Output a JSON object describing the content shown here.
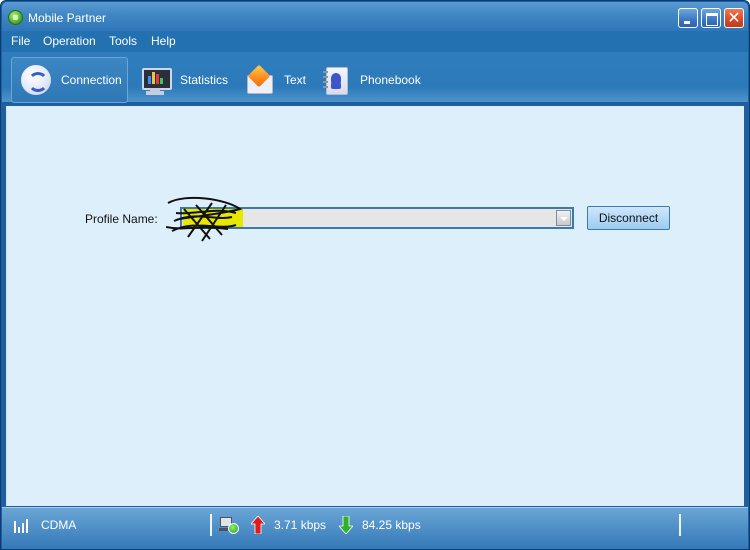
{
  "window": {
    "title": "Mobile Partner",
    "controls": {
      "minimize": "minimize",
      "maximize": "maximize",
      "close": "✕"
    }
  },
  "menu": {
    "items": [
      {
        "label": "File"
      },
      {
        "label": "Operation"
      },
      {
        "label": "Tools"
      },
      {
        "label": "Help"
      }
    ]
  },
  "toolbar": {
    "items": [
      {
        "label": "Connection",
        "icon": "connection-icon",
        "active": true
      },
      {
        "label": "Statistics",
        "icon": "statistics-icon",
        "active": false
      },
      {
        "label": "Text",
        "icon": "envelope-icon",
        "active": false
      },
      {
        "label": "Phonebook",
        "icon": "phonebook-icon",
        "active": false
      }
    ]
  },
  "connection": {
    "profile_label": "Profile Name:",
    "profile_value": "",
    "profile_value_redacted": true,
    "disconnect_label": "Disconnect"
  },
  "statusbar": {
    "network_type": "CDMA",
    "upload_rate": "3.71 kbps",
    "download_rate": "84.25 kbps"
  },
  "colors": {
    "accent": "#2f7dbd",
    "content_bg": "#deeffc",
    "upload_arrow": "#e01b1b",
    "download_arrow": "#2fb12a",
    "close_button": "#d84a24"
  }
}
